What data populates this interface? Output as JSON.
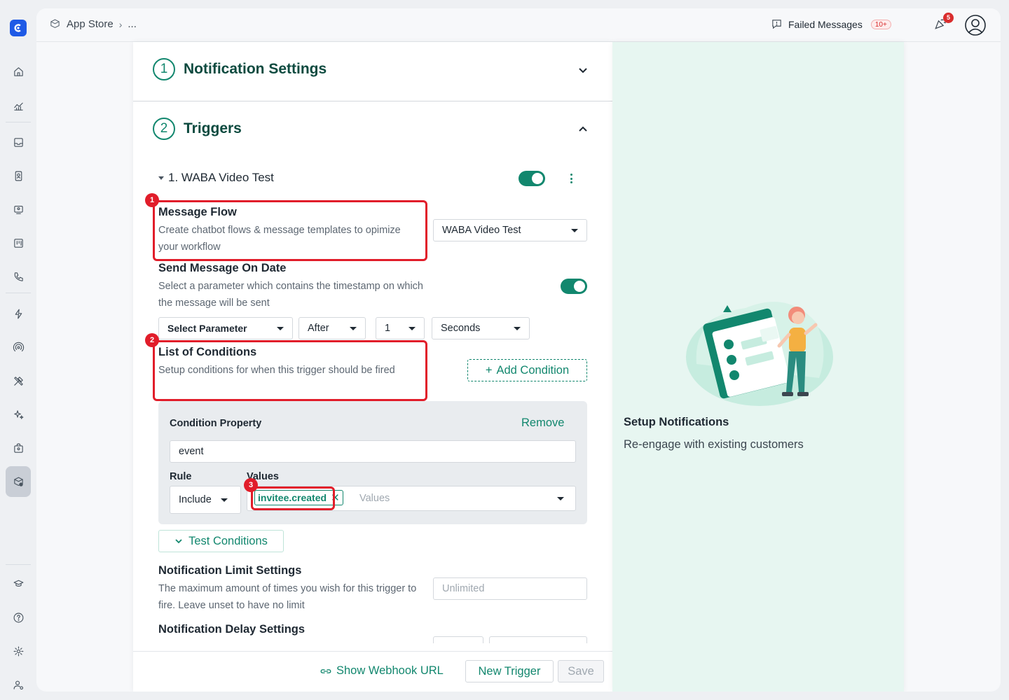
{
  "app": {
    "breadcrumb": [
      "App Store",
      "..."
    ],
    "failed_messages_label": "Failed Messages",
    "failed_messages_badge": "10+",
    "notification_count": "5"
  },
  "sections": {
    "notification_settings": {
      "step": "1",
      "title": "Notification Settings"
    },
    "triggers": {
      "step": "2",
      "title": "Triggers"
    }
  },
  "trigger": {
    "name": "1. WABA Video Test",
    "enabled": true,
    "message_flow": {
      "title": "Message Flow",
      "description": "Create chatbot flows & message templates to opimize your workflow",
      "selected": "WABA Video Test"
    },
    "send_on_date": {
      "title": "Send Message On Date",
      "description": "Select a parameter which contains the timestamp on which the message will be sent",
      "enabled": true,
      "parameter_placeholder": "Select Parameter",
      "timing": "After",
      "amount": "1",
      "unit": "Seconds"
    },
    "conditions": {
      "title": "List of Conditions",
      "description": "Setup conditions for when this trigger should be fired",
      "add_label": "Add Condition",
      "property_label": "Condition Property",
      "remove_label": "Remove",
      "property_value": "event",
      "rule_label": "Rule",
      "rule_value": "Include",
      "values_label": "Values",
      "value_tag": "invitee.created",
      "values_placeholder": "Values",
      "test_label": "Test Conditions"
    },
    "limit": {
      "title": "Notification Limit Settings",
      "description": "The maximum amount of times you wish for this trigger to fire. Leave unset to have no limit",
      "placeholder": "Unlimited"
    },
    "delay": {
      "title": "Notification Delay Settings"
    }
  },
  "annotations": [
    "1",
    "2",
    "3"
  ],
  "footer": {
    "webhook_label": "Show Webhook URL",
    "new_trigger_label": "New Trigger",
    "save_label": "Save"
  },
  "side": {
    "title": "Setup Notifications",
    "subtitle": "Re-engage with existing customers"
  },
  "colors": {
    "accent": "#12876e",
    "highlight": "#e11d2a",
    "brand": "#1e5ae6"
  }
}
